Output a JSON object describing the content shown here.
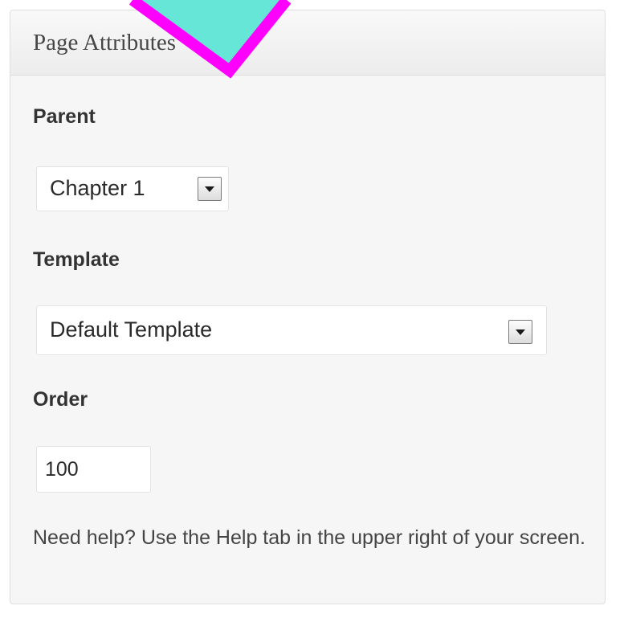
{
  "metabox": {
    "title": "Page Attributes"
  },
  "parent": {
    "label": "Parent",
    "selected": "Chapter 1"
  },
  "template": {
    "label": "Template",
    "selected": "Default Template"
  },
  "order": {
    "label": "Order",
    "value": "100"
  },
  "help_text": "Need help? Use the Help tab in the upper right of your screen.",
  "overlay": {
    "fill_color": "#66e6d6",
    "stroke_color": "#ff00ff"
  }
}
